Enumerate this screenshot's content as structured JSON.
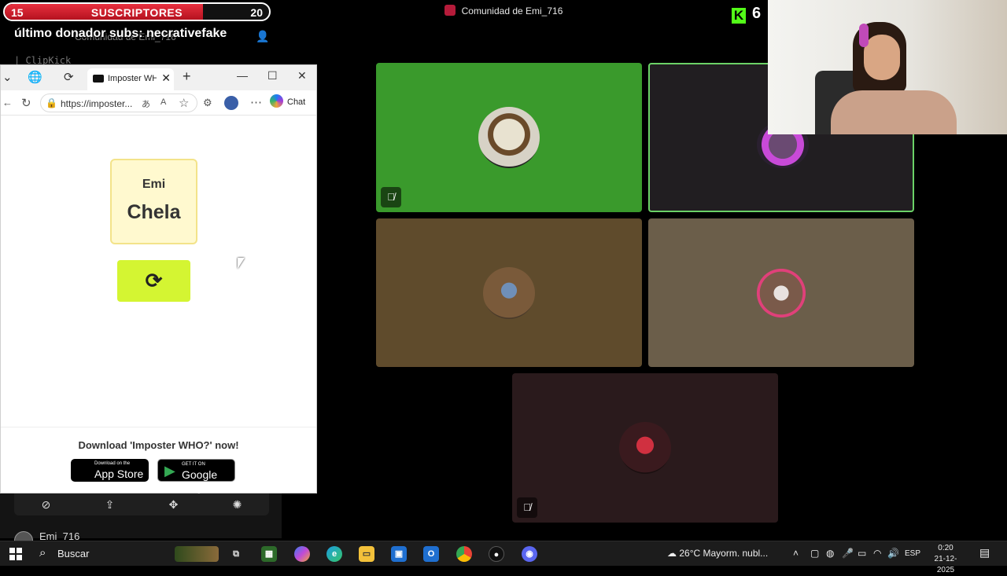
{
  "overlay": {
    "subs_current": "15",
    "subs_label": "SUSCRIPTORES",
    "subs_goal": "20",
    "subs_progress": 0.75,
    "last_donor": "último donador subs: necrativefake",
    "ghost_text": "Comunidad de Emi_716",
    "ghost_text2": "| ClipKick",
    "kick_count": "6"
  },
  "call": {
    "community_title": "Comunidad de Emi_716"
  },
  "browser": {
    "tab_title": "Imposter WHO",
    "url": "https://imposter...",
    "chat_label": "Chat",
    "card_name": "Emi",
    "card_word": "Chela",
    "refresh_icon": "⟳",
    "download_title": "Download 'Imposter WHO?' now!",
    "appstore_small": "Download on the",
    "appstore_big": "App Store",
    "googleplay_small": "GET IT ON",
    "googleplay_big": "Google Play"
  },
  "left_panel": {
    "username": "Emi_716"
  },
  "taskbar": {
    "search_label": "Buscar",
    "weather": "26°C  Mayorm. nubl...",
    "language": "ESP",
    "time": "0:20",
    "date": "21-12-2025"
  }
}
